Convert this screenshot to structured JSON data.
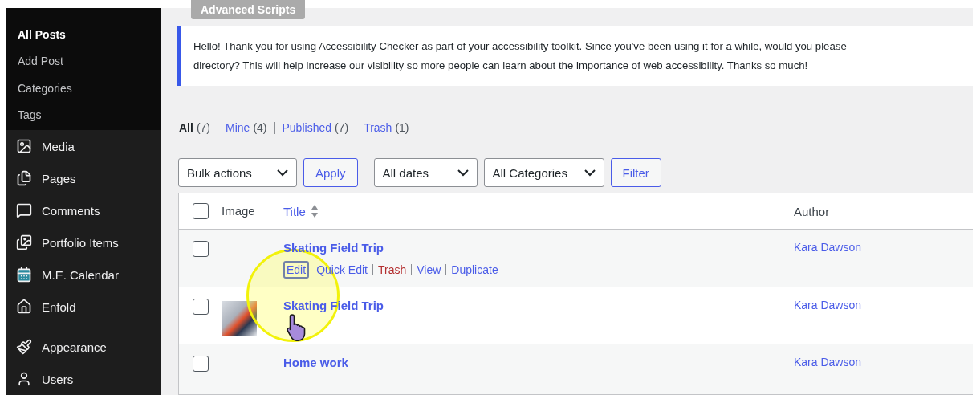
{
  "admin_tab": {
    "label": "Advanced Scripts"
  },
  "sidebar": {
    "submenu": [
      {
        "label": "All Posts",
        "selected": true
      },
      {
        "label": "Add Post",
        "selected": false
      },
      {
        "label": "Categories",
        "selected": false
      },
      {
        "label": "Tags",
        "selected": false
      }
    ],
    "menu_groups": [
      [
        {
          "label": "Media"
        },
        {
          "label": "Pages"
        },
        {
          "label": "Comments"
        },
        {
          "label": "Portfolio Items"
        },
        {
          "label": "M.E. Calendar"
        },
        {
          "label": "Enfold"
        }
      ],
      [
        {
          "label": "Appearance"
        },
        {
          "label": "Users"
        }
      ]
    ]
  },
  "notice": {
    "lines": [
      "Hello! Thank you for using Accessibility Checker as part of your accessibility toolkit. Since you've been using it for a while, would you please",
      "directory? This will help increase our visibility so more people can learn about the importance of web accessibility. Thanks so much!"
    ]
  },
  "views": [
    {
      "label": "All",
      "count": "(7)",
      "selected": true
    },
    {
      "label": "Mine",
      "count": "(4)",
      "selected": false
    },
    {
      "label": "Published",
      "count": "(7)",
      "selected": false
    },
    {
      "label": "Trash",
      "count": "(1)",
      "selected": false
    }
  ],
  "toolbar": {
    "bulk_actions": "Bulk actions",
    "apply": "Apply",
    "dates": "All dates",
    "categories": "All Categories",
    "filter": "Filter"
  },
  "table": {
    "select_all_checked": false,
    "columns": [
      "Image",
      "Title",
      "Author"
    ],
    "rows": [
      {
        "title": "Skating Field Trip",
        "author": "Kara Dawson",
        "image": false,
        "checked": false,
        "actions": [
          {
            "label": "Edit",
            "kind": "link",
            "focused": true
          },
          {
            "label": "Quick Edit",
            "kind": "link",
            "focused": false
          },
          {
            "label": "Trash",
            "kind": "danger",
            "focused": false
          },
          {
            "label": "View",
            "kind": "link",
            "focused": false
          },
          {
            "label": "Duplicate",
            "kind": "link",
            "focused": false
          }
        ]
      },
      {
        "title": "Skating Field Trip",
        "author": "Kara Dawson",
        "image": true,
        "checked": false,
        "actions": []
      },
      {
        "title": "Home work",
        "author": "Kara Dawson",
        "image": false,
        "checked": false,
        "actions": []
      }
    ]
  }
}
